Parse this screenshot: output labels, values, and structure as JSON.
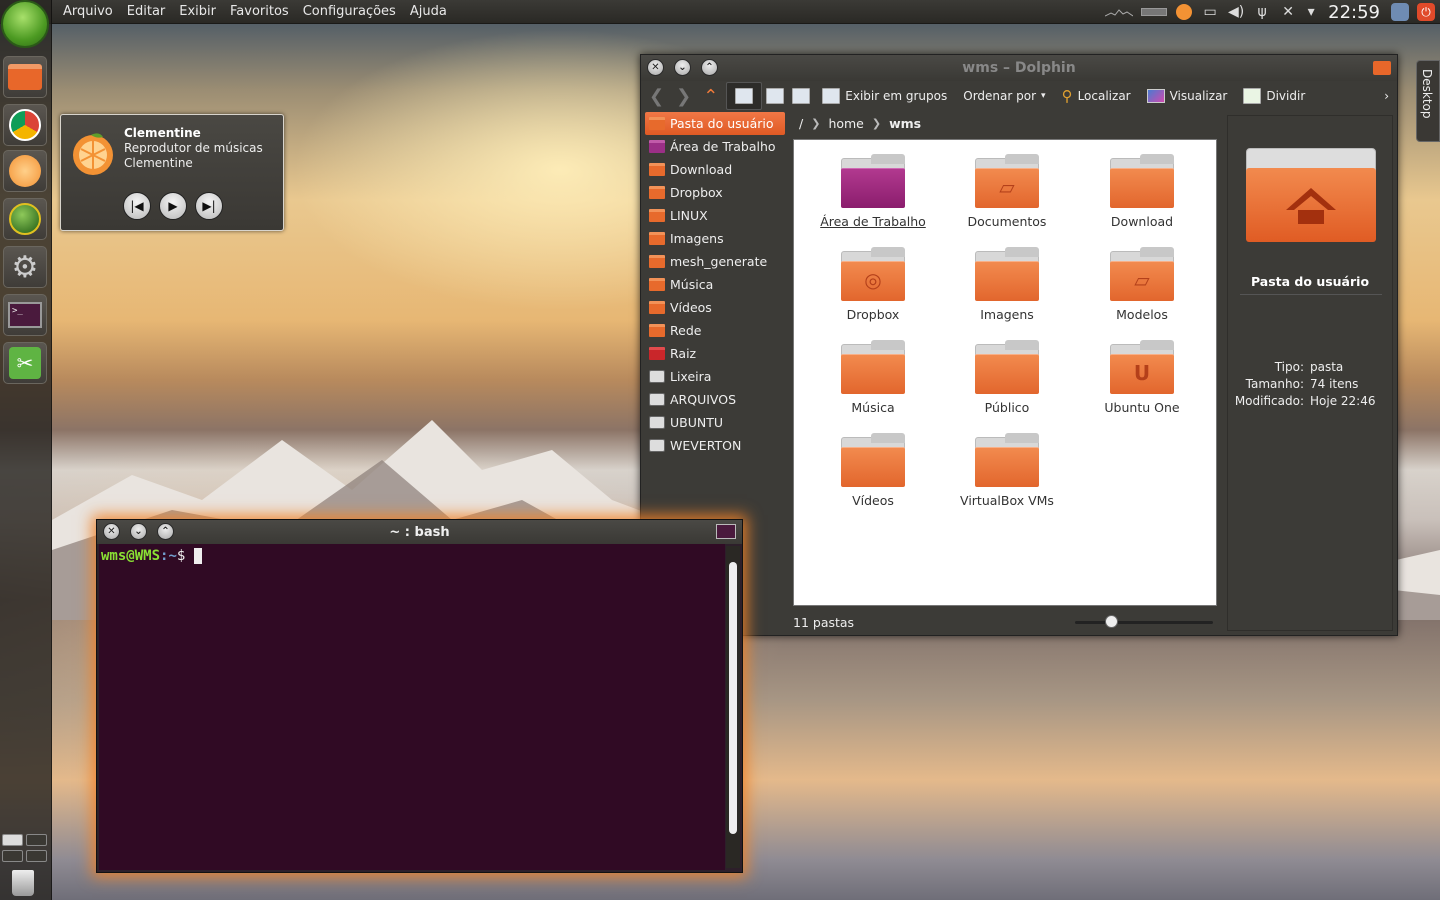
{
  "menubar": [
    "Arquivo",
    "Editar",
    "Exibir",
    "Favoritos",
    "Configurações",
    "Ajuda"
  ],
  "tray": {
    "clock": "22:59"
  },
  "desktop_tab": "Desktop",
  "clementine": {
    "title": "Clementine",
    "subtitle": "Reprodutor de músicas Clementine"
  },
  "dolphin": {
    "title": "wms – Dolphin",
    "toolbar": {
      "groups": "Exibir em grupos",
      "sort": "Ordenar por",
      "find": "Localizar",
      "preview": "Visualizar",
      "split": "Dividir"
    },
    "places": [
      {
        "label": "Pasta do usuário",
        "selected": true
      },
      {
        "label": "Área de Trabalho"
      },
      {
        "label": "Download"
      },
      {
        "label": "Dropbox"
      },
      {
        "label": "LINUX"
      },
      {
        "label": "Imagens"
      },
      {
        "label": "mesh_generate"
      },
      {
        "label": "Música"
      },
      {
        "label": "Vídeos"
      },
      {
        "label": "Rede"
      },
      {
        "label": "Raiz"
      },
      {
        "label": "Lixeira"
      },
      {
        "label": "ARQUIVOS"
      },
      {
        "label": "UBUNTU"
      },
      {
        "label": "WEVERTON"
      }
    ],
    "breadcrumb": {
      "root": "/",
      "home": "home",
      "current": "wms"
    },
    "items": [
      {
        "label": "Área de Trabalho"
      },
      {
        "label": "Documentos"
      },
      {
        "label": "Download"
      },
      {
        "label": "Dropbox"
      },
      {
        "label": "Imagens"
      },
      {
        "label": "Modelos"
      },
      {
        "label": "Música"
      },
      {
        "label": "Público"
      },
      {
        "label": "Ubuntu One"
      },
      {
        "label": "Vídeos"
      },
      {
        "label": "VirtualBox VMs"
      }
    ],
    "status": "11 pastas",
    "info": {
      "title": "Pasta do usuário",
      "rows": [
        {
          "key": "Tipo:",
          "value": "pasta"
        },
        {
          "key": "Tamanho:",
          "value": "74 itens"
        },
        {
          "key": "Modificado:",
          "value": "Hoje 22:46"
        }
      ]
    }
  },
  "terminal": {
    "title": "~ : bash",
    "user": "wms@WMS",
    "path": ":~",
    "prompt": "$"
  }
}
